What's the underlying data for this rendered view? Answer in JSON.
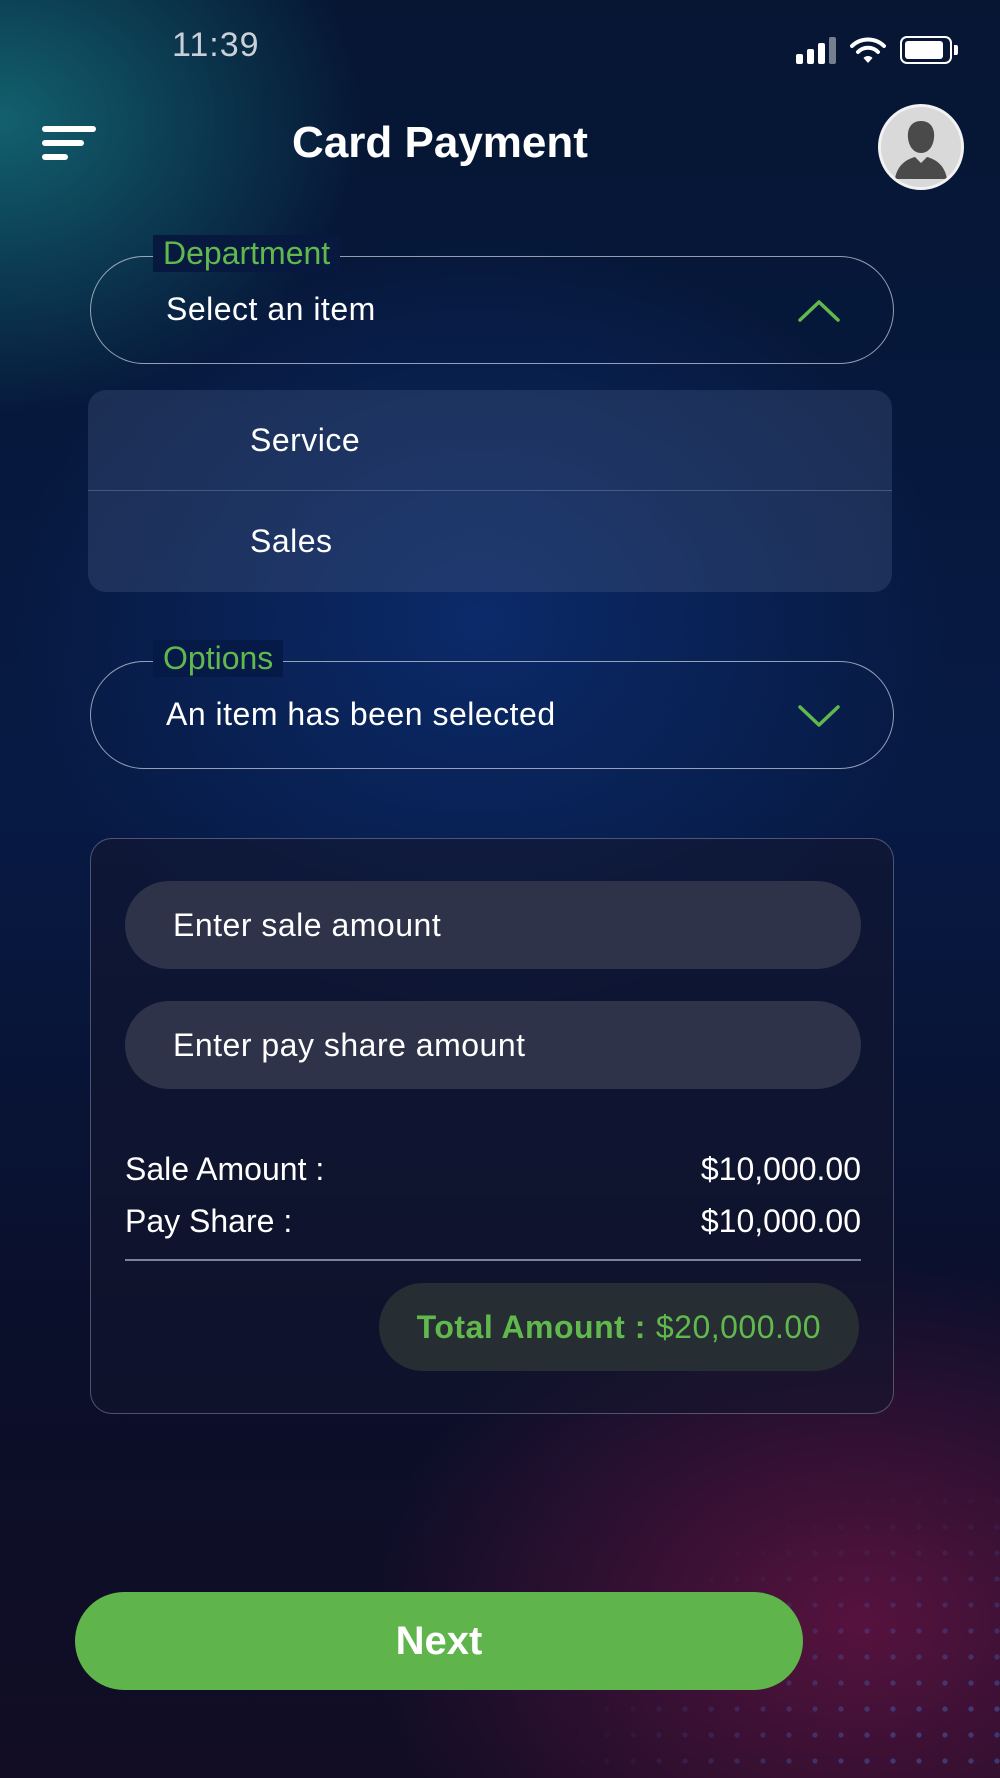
{
  "status_bar": {
    "time": "11:39",
    "icons": [
      "signal-icon",
      "wifi-icon",
      "battery-icon"
    ]
  },
  "header": {
    "title": "Card Payment",
    "menu_icon": "menu-icon",
    "avatar_icon": "user-avatar-icon"
  },
  "department": {
    "legend": "Department",
    "value": "Select an item",
    "expanded": true,
    "options": [
      {
        "label": "Service"
      },
      {
        "label": "Sales"
      }
    ]
  },
  "options_field": {
    "legend": "Options",
    "value": "An item has been selected",
    "expanded": false
  },
  "summary": {
    "sale_input_placeholder": "Enter sale amount",
    "pay_share_input_placeholder": "Enter pay share amount",
    "sale_label": "Sale Amount :",
    "sale_value": "$10,000.00",
    "pay_share_label": "Pay Share :",
    "pay_share_value": "$10,000.00",
    "total_label": "Total Amount :",
    "total_value": "$20,000.00"
  },
  "actions": {
    "next_label": "Next"
  },
  "colors": {
    "accent_green": "#61b94e",
    "button_green": "#5fb54b",
    "input_bg": "#2e3349"
  }
}
